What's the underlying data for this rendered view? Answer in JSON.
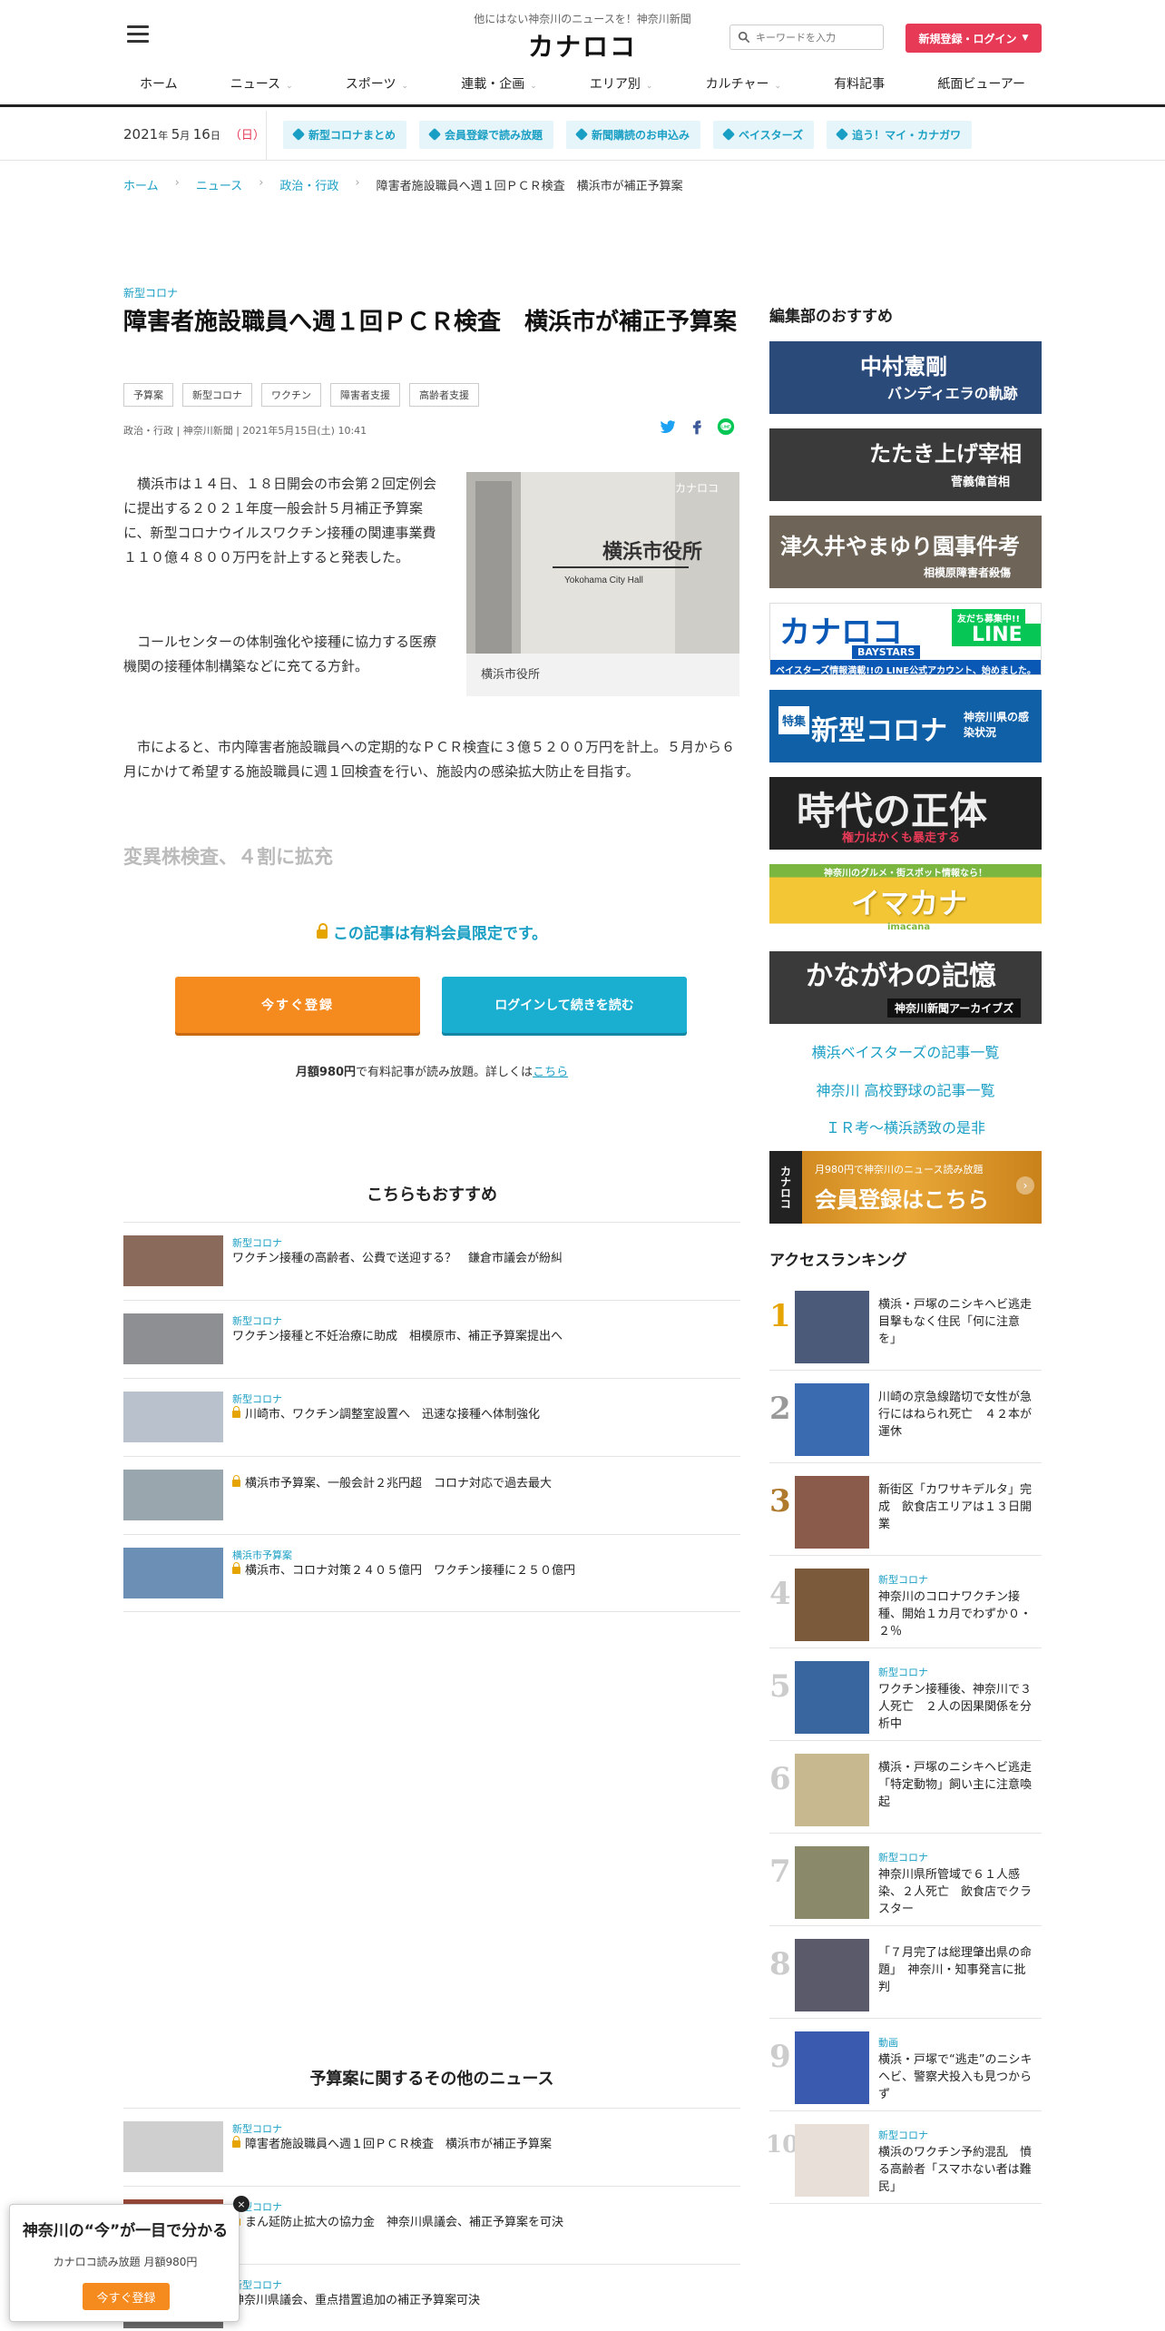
{
  "header": {
    "tagline": "他にはない神奈川のニュースを！神奈川新聞",
    "logo": "カナロコ",
    "search_placeholder": "キーワードを入力",
    "login_label": "新規登録・ログイン"
  },
  "nav": [
    {
      "label": "ホーム",
      "has_dropdown": false
    },
    {
      "label": "ニュース",
      "has_dropdown": true
    },
    {
      "label": "スポーツ",
      "has_dropdown": true
    },
    {
      "label": "連載・企画",
      "has_dropdown": true
    },
    {
      "label": "エリア別",
      "has_dropdown": true
    },
    {
      "label": "カルチャー",
      "has_dropdown": true
    },
    {
      "label": "有料記事",
      "has_dropdown": false
    },
    {
      "label": "紙面ビューアー",
      "has_dropdown": false
    }
  ],
  "datebar": {
    "year": "2021",
    "month": "5",
    "day": "16",
    "weekday": "（日）",
    "tags": [
      "新型コロナまとめ",
      "会員登録で読み放題",
      "新聞購読のお申込み",
      "ベイスターズ",
      "追う！マイ・カナガワ"
    ]
  },
  "breadcrumb": [
    "ホーム",
    "ニュース",
    "政治・行政",
    "障害者施設職員へ週１回ＰＣＲ検査　横浜市が補正予算案"
  ],
  "article": {
    "category": "新型コロナ",
    "title": "障害者施設職員へ週１回ＰＣＲ検査　横浜市が補正予算案",
    "keywords": [
      "予算案",
      "新型コロナ",
      "ワクチン",
      "障害者支援",
      "高齢者支援"
    ],
    "meta": "政治・行政 | 神奈川新聞 | 2021年5月15日(土) 10:41",
    "photo_caption": "横浜市役所",
    "photo_sign": "横浜市役所",
    "photo_sign_en": "Yokohama City Hall",
    "photo_watermark": "カナロコ",
    "p1": "　横浜市は１４日、１８日開会の市会第２回定例会に提出する２０２１年度一般会計５月補正予算案に、新型コロナウイルスワクチン接種の関連事業費１１０億４８００万円を計上すると発表した。",
    "p2": "　コールセンターの体制強化や接種に協力する医療機関の接種体制構築などに充てる方針。",
    "p3": "　市によると、市内障害者施設職員への定期的なＰＣＲ検査に３億５２００万円を計上。５月から６月にかけて希望する施設職員に週１回検査を行い、施設内の感染拡大防止を目指す。",
    "subhead": "変異株検査、４割に拡充",
    "lock_message": "この記事は有料会員限定です。",
    "register_button": "今すぐ登録",
    "login_button": "ログインして続きを読む",
    "price_bold": "月額980円",
    "price_text": "で有料記事が読み放題。詳しくは",
    "price_link": "こちら"
  },
  "recommend": {
    "title": "こちらもおすすめ",
    "items": [
      {
        "category": "新型コロナ",
        "locked": false,
        "title": "ワクチン接種の高齢者、公費で送迎する？　鎌倉市議会が紛糾"
      },
      {
        "category": "新型コロナ",
        "locked": false,
        "title": "ワクチン接種と不妊治療に助成　相模原市、補正予算案提出へ"
      },
      {
        "category": "新型コロナ",
        "locked": true,
        "title": "川崎市、ワクチン調整室設置へ　迅速な接種へ体制強化"
      },
      {
        "category": "",
        "locked": true,
        "title": "横浜市予算案、一般会計２兆円超　コロナ対応で過去最大"
      },
      {
        "category": "横浜市予算案",
        "locked": true,
        "title": "横浜市、コロナ対策２４０５億円　ワクチン接種に２５０億円"
      }
    ]
  },
  "related": {
    "title": "予算案に関するその他のニュース",
    "items": [
      {
        "category": "新型コロナ",
        "locked": true,
        "title": "障害者施設職員へ週１回ＰＣＲ検査　横浜市が補正予算案"
      },
      {
        "category": "新型コロナ",
        "locked": true,
        "title": "まん延防止拡大の協力金　神奈川県議会、補正予算案を可決"
      },
      {
        "category": "新型コロナ",
        "locked": false,
        "title": "神奈川県議会、重点措置追加の補正予算案可決"
      }
    ]
  },
  "sidebar": {
    "editor_title": "編集部のおすすめ",
    "banners": [
      {
        "main": "中村憲剛",
        "sub": "バンディエラの軌跡",
        "color": "#2a4a7a"
      },
      {
        "main": "たたき上げ宰相",
        "sub": "菅義偉首相",
        "color": "#3a3a3a"
      },
      {
        "main": "津久井やまゆり園事件考",
        "sub": "相模原障害者殺傷",
        "color": "#6e6558"
      },
      {
        "main": "カナロコ",
        "sub": "ベイスターズ情報満載!!の LINE公式アカウント、始めました。",
        "extra1": "友だち募集中!!",
        "extra2": "LINE",
        "extra3": "BAYSTARS",
        "color": "#0a58b5"
      },
      {
        "main": "新型コロナ",
        "sub": "神奈川県の感染状況",
        "extra1": "特集",
        "color": "#1060a8"
      },
      {
        "main": "時代の正体",
        "sub": "権力はかくも暴走する",
        "color": "#222222"
      },
      {
        "main": "イマカナ",
        "sub": "imacana",
        "extra1": "神奈川のグルメ・街スポット情報なら！",
        "color": "#7ab640"
      },
      {
        "main": "かながわの記憶",
        "sub": "神奈川新聞アーカイブズ",
        "color": "#3a3a3a"
      }
    ],
    "links": [
      "横浜ベイスターズの記事一覧",
      "神奈川 高校野球の記事一覧",
      "ＩＲ考～横浜誘致の是非"
    ],
    "member_banner": {
      "top": "月980円で神奈川のニュース読み放題",
      "main": "会員登録はこちら",
      "logo": "カナロコ"
    },
    "ranking_title": "アクセスランキング",
    "ranking": [
      {
        "rank": "1",
        "category": "",
        "title": "横浜・戸塚のニシキヘビ逃走　目撃もなく住民「何に注意を」"
      },
      {
        "rank": "2",
        "category": "",
        "title": "川崎の京急線踏切で女性が急行にはねられ死亡　４２本が運休"
      },
      {
        "rank": "3",
        "category": "",
        "title": "新街区「カワサキデルタ」完成　飲食店エリアは１３日開業"
      },
      {
        "rank": "4",
        "category": "新型コロナ",
        "title": "神奈川のコロナワクチン接種、開始１カ月でわずか０・２％"
      },
      {
        "rank": "5",
        "category": "新型コロナ",
        "title": "ワクチン接種後、神奈川で３人死亡　２人の因果関係を分析中"
      },
      {
        "rank": "6",
        "category": "",
        "title": "横浜・戸塚のニシキヘビ逃走　「特定動物」飼い主に注意喚起"
      },
      {
        "rank": "7",
        "category": "新型コロナ",
        "title": "神奈川県所管域で６１人感染、２人死亡　飲食店でクラスター"
      },
      {
        "rank": "8",
        "category": "",
        "title": "「７月完了は総理肇出県の命題」　神奈川・知事発言に批判"
      },
      {
        "rank": "9",
        "category": "動画",
        "title": "横浜・戸塚で“逃走”のニシキヘビ、警察犬投入も見つからず"
      },
      {
        "rank": "10",
        "category": "新型コロナ",
        "title": "横浜のワクチン予約混乱　憤る高齢者「スマホない者は難民」"
      }
    ]
  },
  "popup": {
    "title": "神奈川の“今”が一目で分かる",
    "sub": "カナロコ読み放題 月額980円",
    "button": "今すぐ登録",
    "close": "×"
  }
}
